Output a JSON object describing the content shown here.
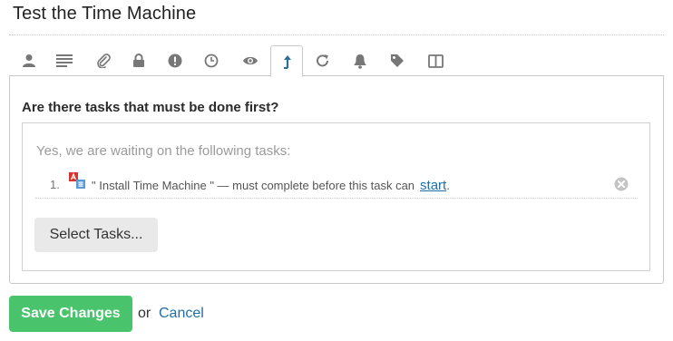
{
  "task_title": "Test the Time Machine",
  "tabs": [
    {
      "icon": "person-icon",
      "active": false
    },
    {
      "icon": "description-icon",
      "active": false
    },
    {
      "icon": "paperclip-icon",
      "active": false
    },
    {
      "icon": "lock-icon",
      "active": false
    },
    {
      "icon": "alert-icon",
      "active": false
    },
    {
      "icon": "clock-icon",
      "active": false
    },
    {
      "icon": "eye-icon",
      "active": false
    },
    {
      "icon": "dependency-icon",
      "active": true
    },
    {
      "icon": "repeat-icon",
      "active": false
    },
    {
      "icon": "bell-icon",
      "active": false
    },
    {
      "icon": "tag-icon",
      "active": false
    },
    {
      "icon": "columns-icon",
      "active": false
    }
  ],
  "dependencies": {
    "question": "Are there tasks that must be done first?",
    "waiting_text": "Yes, we are waiting on the following tasks:",
    "items": [
      {
        "number": "1.",
        "text": "\" Install Time Machine \" — must complete before this task can",
        "link": "start",
        "suffix": "."
      }
    ],
    "select_label": "Select Tasks..."
  },
  "footer": {
    "save_label": "Save Changes",
    "or_text": "or",
    "cancel_label": "Cancel"
  },
  "colors": {
    "accent_green": "#49c46d",
    "link_blue": "#1f6fa8",
    "icon_gray": "#777777",
    "active_icon": "#2a6e9c"
  }
}
